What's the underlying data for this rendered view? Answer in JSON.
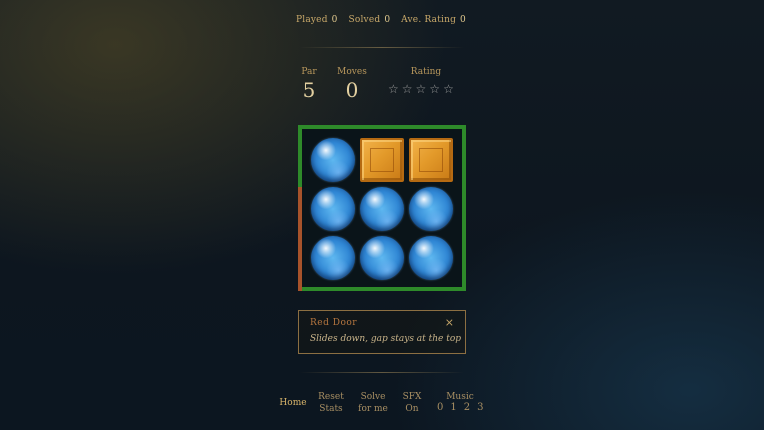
{
  "stats": {
    "played_label": "Played",
    "played_value": "0",
    "solved_label": "Solved",
    "solved_value": "0",
    "rating_label": "Ave. Rating",
    "rating_value": "0"
  },
  "hud": {
    "par_label": "Par",
    "par_value": "5",
    "moves_label": "Moves",
    "moves_value": "0",
    "rating_label": "Rating",
    "stars_filled": 0,
    "stars_total": 5,
    "star_glyph": "☆"
  },
  "board": {
    "rows": 3,
    "cols": 3,
    "cells": [
      [
        "sphere",
        "crate",
        "crate"
      ],
      [
        "sphere",
        "sphere",
        "sphere"
      ],
      [
        "sphere",
        "sphere",
        "sphere"
      ]
    ],
    "frame_color": "#2e8a2a",
    "door_color": "#a7532b"
  },
  "info": {
    "title": "Red Door",
    "description": "Slides down, gap stays at the top",
    "close_glyph": "×"
  },
  "nav": {
    "home": "Home",
    "reset_line1": "Reset",
    "reset_line2": "Stats",
    "solve_line1": "Solve",
    "solve_line2": "for me",
    "sfx_line1": "SFX",
    "sfx_line2": "On",
    "music_label": "Music",
    "music_levels": [
      "0",
      "1",
      "2",
      "3"
    ]
  },
  "colors": {
    "gold": "#c9a96a",
    "accent": "#d8b46a"
  }
}
